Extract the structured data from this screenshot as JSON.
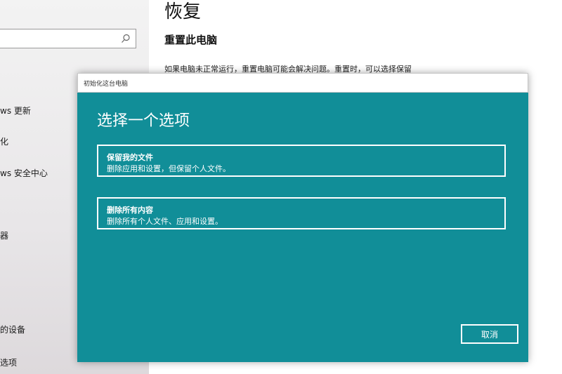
{
  "settings": {
    "page_title": "恢复",
    "section_title": "重置此电脑",
    "section_desc": "如果电脑未正常运行，重置电脑可能会解决问题。重置时，可以选择保留",
    "sidebar_items": [
      {
        "label": "ws 更新"
      },
      {
        "label": "化"
      },
      {
        "label": "ws 安全中心"
      },
      {
        "label": "器"
      },
      {
        "label": "的设备"
      },
      {
        "label": "选项"
      }
    ]
  },
  "dialog": {
    "title": "初始化这台电脑",
    "heading": "选择一个选项",
    "options": [
      {
        "title": "保留我的文件",
        "desc": "删除应用和设置，但保留个人文件。"
      },
      {
        "title": "删除所有内容",
        "desc": "删除所有个人文件、应用和设置。"
      }
    ],
    "cancel_label": "取消"
  },
  "colors": {
    "dialog_bg": "#118e98",
    "dialog_text": "#ffffff"
  }
}
